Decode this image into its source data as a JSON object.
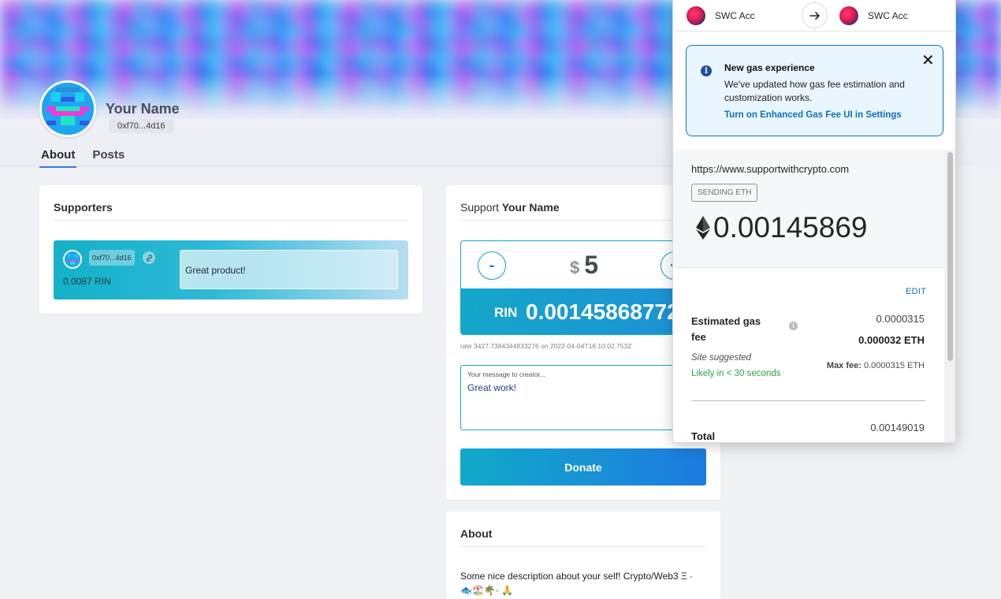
{
  "profile": {
    "name": "Your Name",
    "address": "0xf70...4d16"
  },
  "tabs": [
    {
      "label": "About",
      "active": true
    },
    {
      "label": "Posts",
      "active": false
    }
  ],
  "supporters": {
    "title": "Supporters",
    "items": [
      {
        "address": "0xf70...4d16",
        "amount": "0.0087 RIN",
        "message": "Great product!",
        "link_icon": "link-icon"
      }
    ]
  },
  "support": {
    "title_prefix": "Support",
    "title_name": "Your Name",
    "minus_label": "-",
    "plus_label": "+",
    "currency_symbol": "$",
    "usd_amount": "5",
    "crypto_currency": "RIN",
    "crypto_amount": "0.00145868772",
    "rate": "rate 3427.7384344833276 on 2022-04-04T16:10:02.753Z",
    "message_placeholder": "Your message to creator...",
    "message_value": "Great work!",
    "donate_label": "Donate"
  },
  "about": {
    "title": "About",
    "text": "Some nice description about your self! Crypto/Web3 Ξ · 🐟🏖️🌴· 🙏"
  },
  "metamask": {
    "from_account": "SWC Acc",
    "to_account": "SWC Acc",
    "notice": {
      "title": "New gas experience",
      "body": "We've updated how gas fee estimation and customization works.",
      "link": "Turn on Enhanced Gas Fee UI in Settings",
      "close": "✕"
    },
    "origin": "https://www.supportwithcrypto.com",
    "sending_label": "SENDING ETH",
    "amount": "0.00145869",
    "edit_label": "EDIT",
    "gas_label": "Estimated gas fee",
    "gas_value_fiat": "0.0000315",
    "gas_value_eth": "0.000032 ETH",
    "site_suggested": "Site suggested",
    "likely": "Likely in < 30 seconds",
    "max_fee_label": "Max fee:",
    "max_fee_value": "0.0000315 ETH",
    "total_label": "Total",
    "total_value": "0.00149019"
  },
  "colors": {
    "accent": "#1e8fd7",
    "teal": "#14a7ca",
    "link": "#0c70c0",
    "success": "#28a745"
  }
}
